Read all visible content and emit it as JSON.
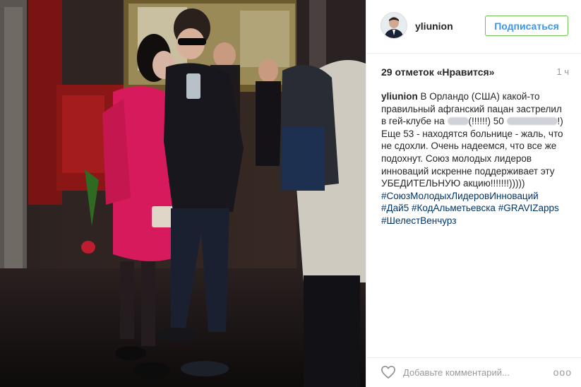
{
  "post": {
    "username": "yliunion",
    "follow_label": "Подписаться",
    "likes": "29 отметок «Нравится»",
    "time": "1 ч",
    "caption": {
      "username": "yliunion",
      "line1": " В Орландо (США) какой-то",
      "line2": "правильный афганский пацан застрелил",
      "line3a": "в гей-клубе на ",
      "line3b": "(!!!!!!) 50 ",
      "line3c": "!)",
      "line4": "Еще 53 - находятся больнице - жаль, что",
      "line5": "не сдохли. Очень надеемся, что все же",
      "line6": "подохнут. Союз молодых лидеров",
      "line7": "инноваций искренне поддерживает эту",
      "line8": "УБЕДИТЕЛЬНУЮ акцию!!!!!!!)))))",
      "tag1": "#СоюзМолодыхЛидеровИнноваций",
      "tag2": "#Дай5",
      "tag3": "#КодАльметьевска",
      "tag4": "#GRAVIZapps",
      "tag5": "#ШелестВенчурз"
    },
    "comment_placeholder": "Добавьте комментарий...",
    "more_label": "ooo"
  },
  "colors": {
    "link": "#003569",
    "follow_text": "#3897f0",
    "follow_border": "#70c050",
    "muted": "#999999"
  },
  "icons": [
    "heart-icon",
    "more-options-icon",
    "avatar"
  ]
}
